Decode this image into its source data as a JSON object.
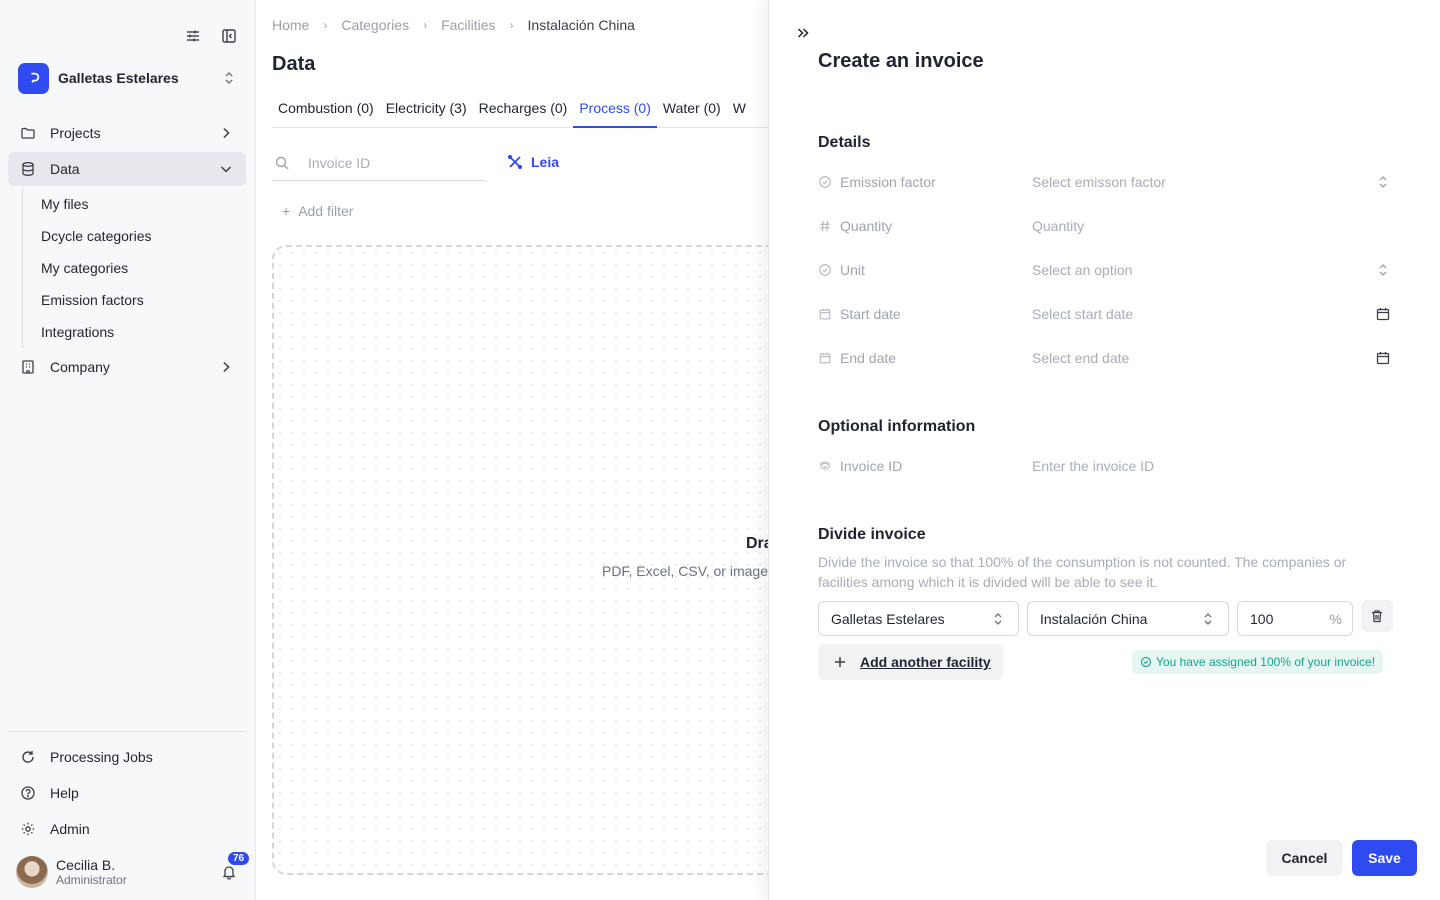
{
  "sidebar": {
    "org_name": "Galletas Estelares",
    "nav": {
      "projects": "Projects",
      "data": "Data",
      "company": "Company"
    },
    "sub_items": [
      "My files",
      "Dcycle categories",
      "My categories",
      "Emission factors",
      "Integrations"
    ],
    "bottom": {
      "processing_jobs": "Processing Jobs",
      "help": "Help",
      "admin": "Admin"
    },
    "user": {
      "name": "Cecilia B.",
      "role": "Administrator",
      "notifications": "76"
    }
  },
  "main": {
    "breadcrumb": [
      "Home",
      "Categories",
      "Facilities",
      "Instalación China"
    ],
    "title": "Data",
    "tabs": [
      "Combustion (0)",
      "Electricity (3)",
      "Recharges (0)",
      "Process (0)",
      "Water (0)",
      "W"
    ],
    "active_tab": "Process (0)",
    "search_placeholder": "Invoice ID",
    "leia_label": "Leia",
    "add_filter": "Add filter",
    "drop_title": "Dra",
    "drop_subtitle": "PDF, Excel, CSV, or image"
  },
  "drawer": {
    "title": "Create an invoice",
    "details_title": "Details",
    "fields": {
      "emission_factor": {
        "label": "Emission factor",
        "placeholder": "Select emisson factor"
      },
      "quantity": {
        "label": "Quantity",
        "placeholder": "Quantity"
      },
      "unit": {
        "label": "Unit",
        "placeholder": "Select an option"
      },
      "start_date": {
        "label": "Start date",
        "placeholder": "Select start date"
      },
      "end_date": {
        "label": "End date",
        "placeholder": "Select end date"
      }
    },
    "optional_title": "Optional information",
    "invoice_id": {
      "label": "Invoice ID",
      "placeholder": "Enter the invoice ID"
    },
    "divide_title": "Divide invoice",
    "divide_desc": "Divide the invoice so that 100% of the consumption is not counted. The companies or facilities among which it is divided will be able to see it.",
    "division": {
      "company": "Galletas Estelares",
      "facility": "Instalación China",
      "percentage": "100",
      "unit": "%"
    },
    "add_facility": "Add another facility",
    "assigned_msg": "You have assigned 100% of your invoice!",
    "cancel": "Cancel",
    "save": "Save"
  },
  "colors": {
    "accent": "#2f4bf0",
    "success": "#14a58b"
  }
}
